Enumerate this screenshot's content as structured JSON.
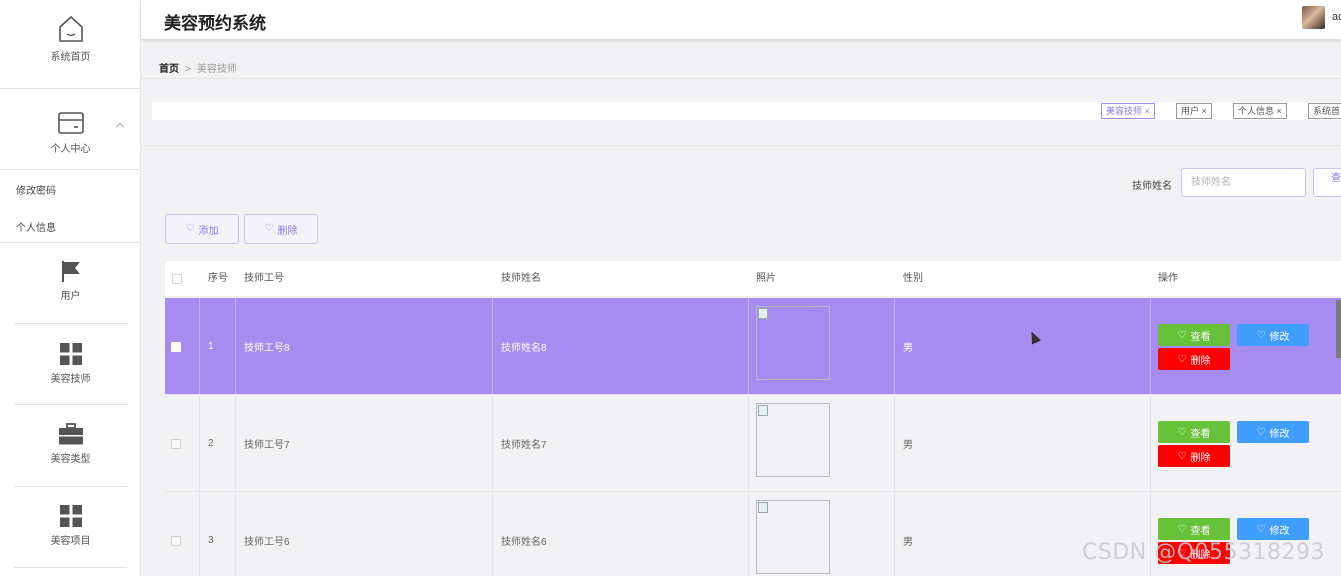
{
  "app": {
    "title": "美容预约系统",
    "username": "ac"
  },
  "sidebar": {
    "home": "系统首页",
    "personal": "个人中心",
    "personal_sub": [
      "修改密码",
      "个人信息"
    ],
    "user": "用户",
    "technician": "美容技师",
    "type": "美容类型",
    "project": "美容项目"
  },
  "breadcrumb": {
    "home": "首页",
    "separator": ">",
    "current": "美容技师"
  },
  "tags": [
    "美容技师",
    "用户",
    "个人信息",
    "系统首"
  ],
  "search": {
    "label": "技师姓名",
    "placeholder": "技师姓名",
    "button": "查"
  },
  "actions": {
    "add": "添加",
    "delete": "删除"
  },
  "table": {
    "columns": [
      "序号",
      "技师工号",
      "技师姓名",
      "照片",
      "性别",
      "操作"
    ],
    "rows": [
      {
        "index": "1",
        "number": "技师工号8",
        "name": "技师姓名8",
        "gender": "男"
      },
      {
        "index": "2",
        "number": "技师工号7",
        "name": "技师姓名7",
        "gender": "男"
      },
      {
        "index": "3",
        "number": "技师工号6",
        "name": "技师姓名6",
        "gender": "男"
      }
    ],
    "ops": {
      "view": "查看",
      "edit": "修改",
      "delete": "删除"
    }
  },
  "watermark": "CSDN @Q055318293",
  "colors": {
    "accent": "#a68cf0",
    "view": "#67c23a",
    "edit": "#409eff",
    "delete": "#ff0000"
  }
}
